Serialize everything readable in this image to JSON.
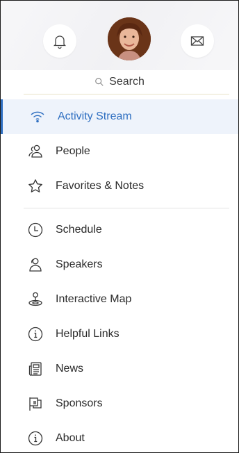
{
  "header": {
    "notifications_icon": "bell-icon",
    "messages_icon": "envelope-icon",
    "avatar": "user-avatar"
  },
  "search": {
    "label": "Search",
    "icon": "search-icon"
  },
  "menu": {
    "items": [
      {
        "label": "Activity Stream",
        "icon": "wifi-icon",
        "active": true
      },
      {
        "label": "People",
        "icon": "people-icon"
      },
      {
        "label": "Favorites & Notes",
        "icon": "star-icon"
      },
      {
        "label": "Schedule",
        "icon": "clock-icon"
      },
      {
        "label": "Speakers",
        "icon": "speakers-icon"
      },
      {
        "label": "Interactive Map",
        "icon": "map-pin-icon"
      },
      {
        "label": "Helpful Links",
        "icon": "info-icon"
      },
      {
        "label": "News",
        "icon": "newspaper-icon"
      },
      {
        "label": "Sponsors",
        "icon": "flag-icon"
      },
      {
        "label": "About",
        "icon": "info-icon"
      }
    ]
  },
  "colors": {
    "accent": "#2f6fc1",
    "active_bg": "#eef3fb",
    "text": "#2a2a2a"
  }
}
